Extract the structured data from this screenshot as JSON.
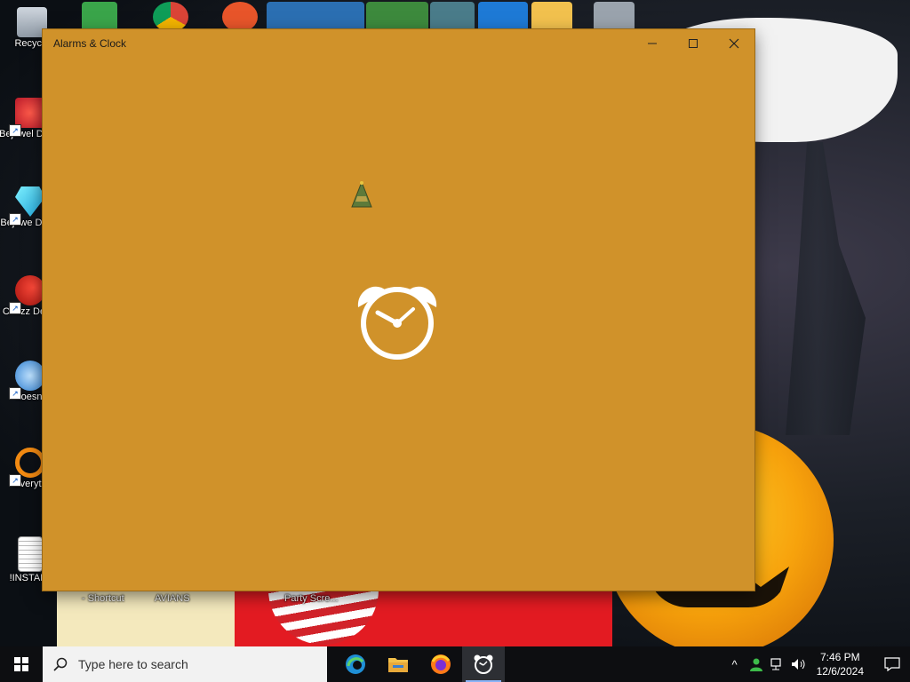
{
  "window": {
    "title": "Alarms & Clock",
    "background_color": "#d0922a",
    "minimize_icon": "minimize-icon",
    "maximize_icon": "maximize-icon",
    "close_icon": "close-icon",
    "splash_icon": "alarm-clock-icon"
  },
  "desktop_icons": [
    {
      "label": "Recycle",
      "icon": "recycle-bin-icon"
    },
    {
      "label": "Bejewel Delux",
      "icon": "bejeweled-2-icon",
      "shortcut": true
    },
    {
      "label": "Bejewe Delux",
      "icon": "bejeweled-diamond-icon",
      "shortcut": true
    },
    {
      "label": "Chuzz Delux",
      "icon": "chuzzle-icon",
      "shortcut": true
    },
    {
      "label": "doesnt",
      "icon": "blue-globe-icon",
      "shortcut": true
    },
    {
      "label": "Everyth",
      "icon": "everything-search-icon",
      "shortcut": true
    },
    {
      "label": "!INSTALL",
      "icon": "text-document-icon"
    }
  ],
  "desktop_labels": {
    "shortcut": "- Shortcut",
    "avians": "AVIANS",
    "party": "Party Scre..."
  },
  "top_icons": [
    "users-icon",
    "chrome-icon",
    "app-icon",
    "photos-icon",
    "image-viewer-icon",
    "avatar-icon",
    "windows-icon",
    "folder-icon",
    "recycle-bin-icon"
  ],
  "taskbar": {
    "start_icon": "windows-start-icon",
    "search_placeholder": "Type here to search",
    "search_icon": "search-icon",
    "apps": [
      {
        "name": "edge-icon",
        "active": false
      },
      {
        "name": "file-explorer-icon",
        "active": false
      },
      {
        "name": "firefox-icon",
        "active": false
      },
      {
        "name": "alarms-clock-icon",
        "active": true
      }
    ],
    "tray": {
      "chevron": "^",
      "people_icon": "people-icon",
      "network_icon": "network-icon",
      "volume_icon": "volume-icon",
      "time": "7:46 PM",
      "date": "12/6/2024",
      "notification_icon": "action-center-icon"
    }
  }
}
